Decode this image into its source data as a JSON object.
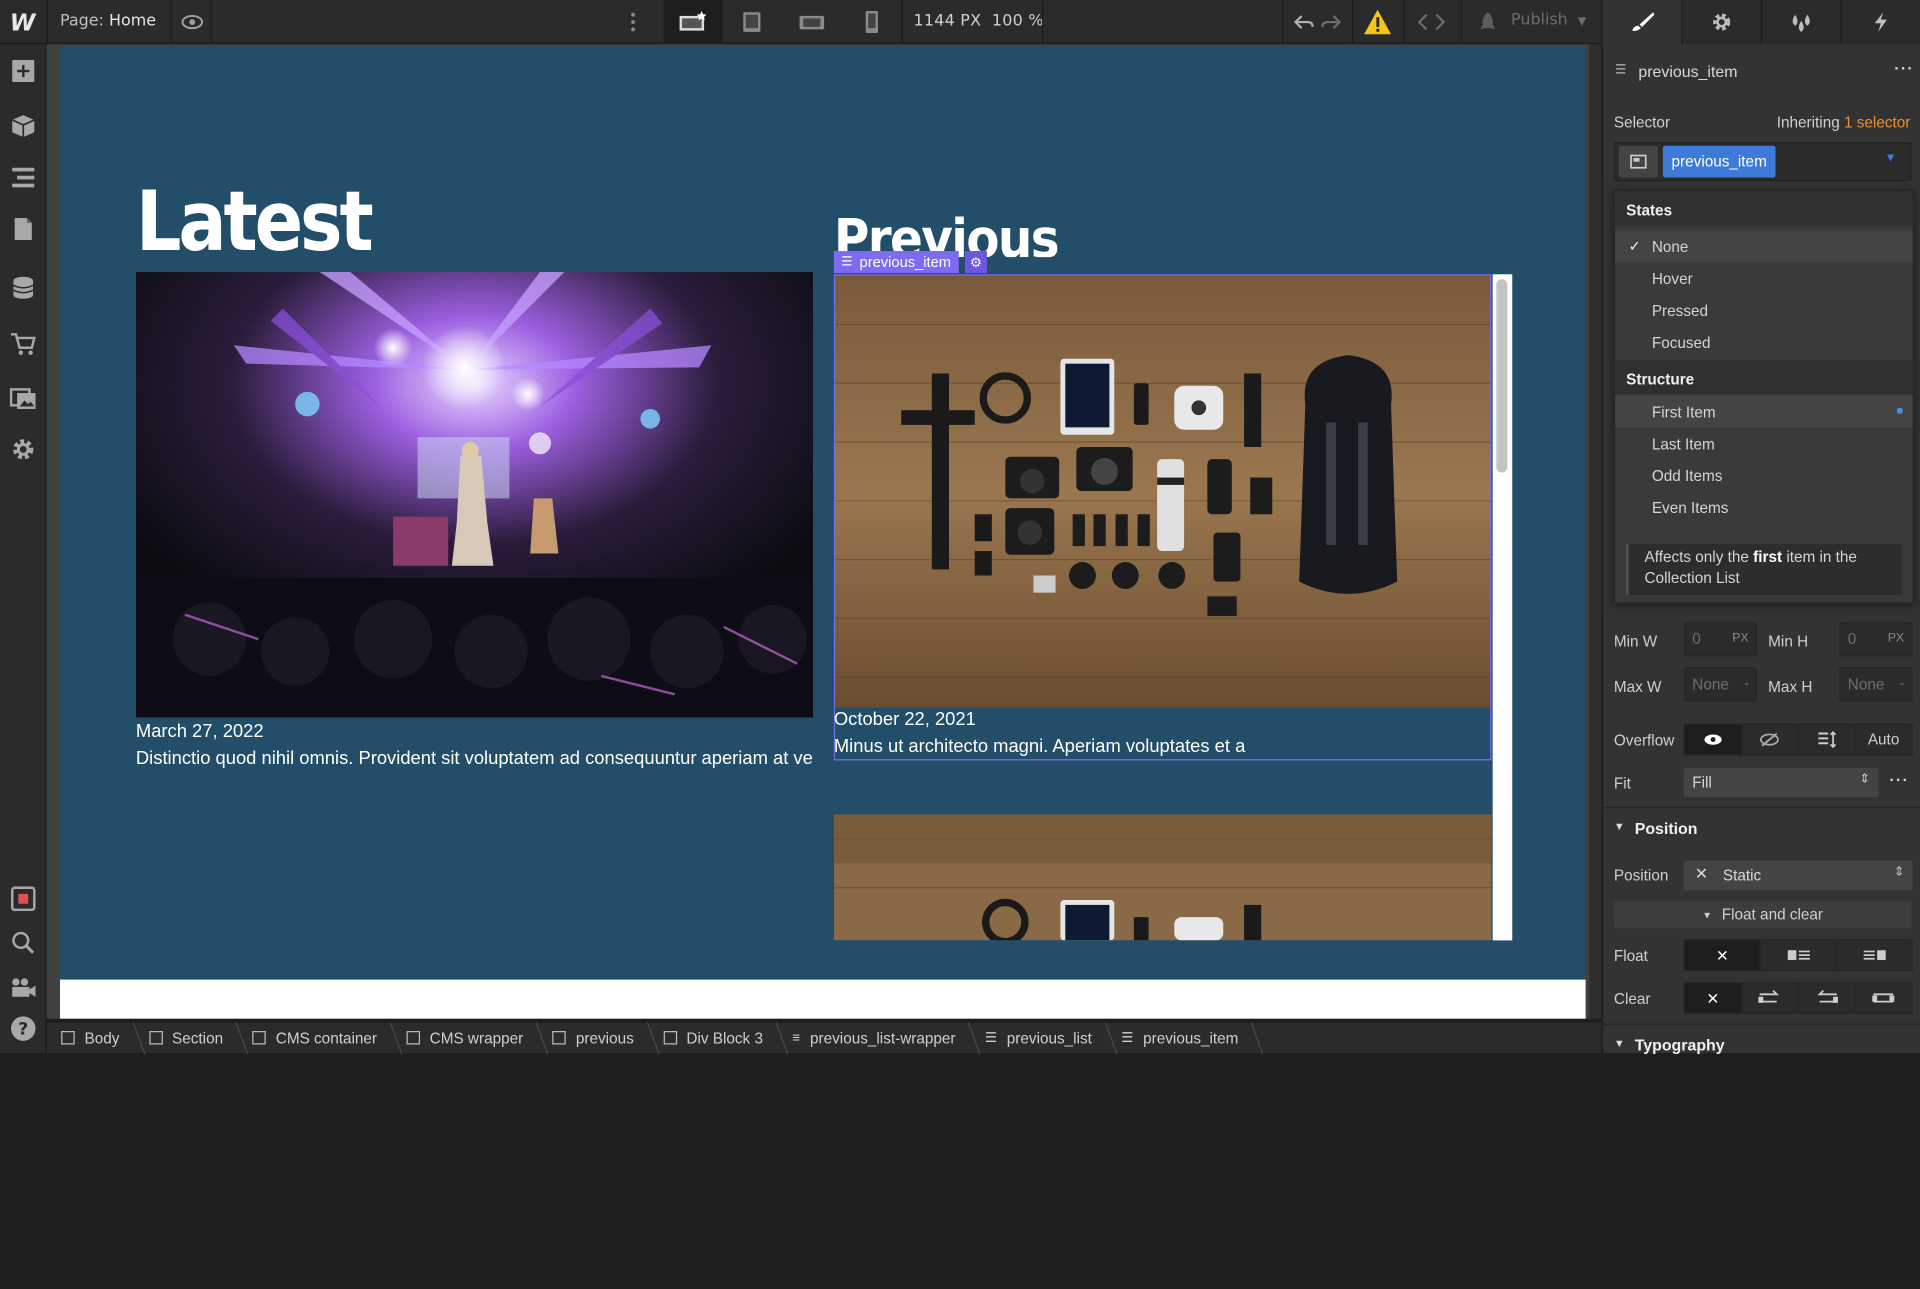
{
  "topbar": {
    "page_prefix": "Page:",
    "page_name": "Home",
    "canvas_width": "1144 PX",
    "zoom": "100 %",
    "publish_label": "Publish"
  },
  "canvas": {
    "latest_heading": "Latest",
    "previous_heading": "Previous",
    "latest_date": "March 27, 2022",
    "latest_body": "Distinctio quod nihil omnis. Provident sit voluptatem ad consequuntur aperiam at ve",
    "previous_date": "October 22, 2021",
    "previous_body": "Minus ut architecto magni. Aperiam voluptates et a",
    "selected_label": "previous_item"
  },
  "breadcrumb": [
    {
      "label": "Body"
    },
    {
      "label": "Section"
    },
    {
      "label": "CMS container"
    },
    {
      "label": "CMS wrapper"
    },
    {
      "label": "previous"
    },
    {
      "label": "Div Block 3"
    },
    {
      "label": "previous_list-wrapper"
    },
    {
      "label": "previous_list"
    },
    {
      "label": "previous_item"
    }
  ],
  "panel": {
    "element_name": "previous_item",
    "selector_label": "Selector",
    "inheriting_prefix": "Inheriting",
    "inheriting_link": "1 selector",
    "selector_chip": "previous_item",
    "states_header": "States",
    "states": [
      "None",
      "Hover",
      "Pressed",
      "Focused"
    ],
    "structure_header": "Structure",
    "structure": [
      "First Item",
      "Last Item",
      "Odd Items",
      "Even Items"
    ],
    "tip_pre": "Affects only the ",
    "tip_bold": "first",
    "tip_post": " item in the Collection List",
    "min_w_label": "Min W",
    "min_w_value": "0",
    "min_h_label": "Min H",
    "min_h_value": "0",
    "max_w_label": "Max W",
    "max_w_value": "None",
    "max_h_label": "Max H",
    "max_h_value": "None",
    "unit_px": "PX",
    "unit_dash": "-",
    "overflow_label": "Overflow",
    "overflow_auto": "Auto",
    "fit_label": "Fit",
    "fit_value": "Fill",
    "position_section": "Position",
    "position_label": "Position",
    "position_value": "Static",
    "float_clear_label": "Float and clear",
    "float_label": "Float",
    "clear_label": "Clear",
    "typography_section": "Typography"
  },
  "colors": {
    "page_bg": "#234e69",
    "selection": "#7d6cf0",
    "selector_chip": "#3e7bd8",
    "warning": "#f5c518",
    "inherit_link": "#e8913a"
  }
}
